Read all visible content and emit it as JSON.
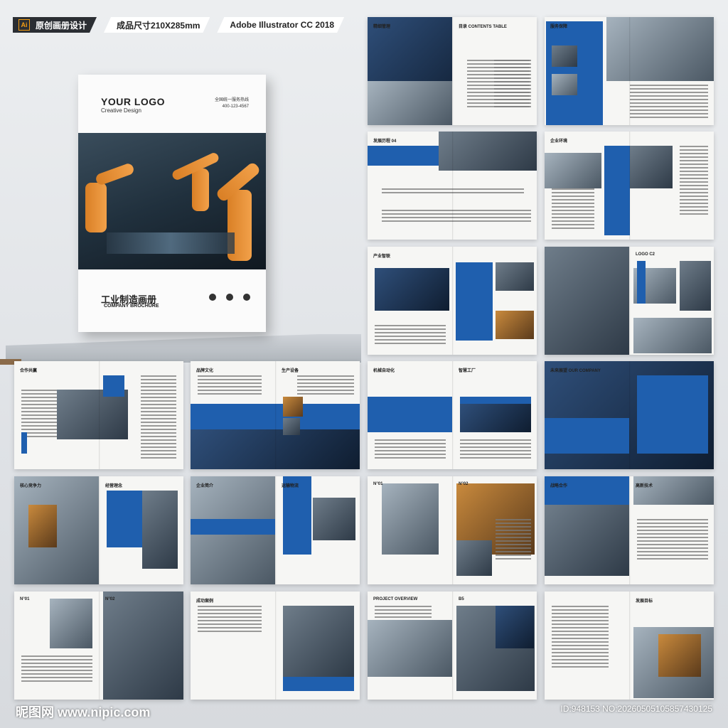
{
  "badges": {
    "software_icon": "Ai",
    "label": "原创画册设计",
    "size": "成品尺寸210X285mm",
    "software": "Adobe Illustrator CC 2018"
  },
  "cover": {
    "logo": "YOUR LOGO",
    "logo_sub": "Creative Design",
    "hotline_label": "全国统一服务热线",
    "hotline_number": "400-123-4567",
    "title": "工业制造画册",
    "title_en": "COMPANY BROCHURE"
  },
  "spreads": [
    {
      "left_title": "精细管理",
      "right_title": "目录 CONTENTS TABLE"
    },
    {
      "left_title": "服务保障",
      "right_title": ""
    },
    {
      "left_title": "发展历程 04",
      "right_title": ""
    },
    {
      "left_title": "企业环境",
      "right_title": ""
    },
    {
      "left_title": "产业智联",
      "right_title": ""
    },
    {
      "left_title": "",
      "right_title": "LOGO C2"
    },
    {
      "left_title": "合作共赢",
      "right_title": ""
    },
    {
      "left_title": "品牌文化",
      "right_title": "生产设备"
    },
    {
      "left_title": "机械自动化",
      "right_title": "智慧工厂"
    },
    {
      "left_title": "未来展望 OUR COMPANY",
      "right_title": ""
    },
    {
      "left_title": "核心竞争力",
      "right_title": "经营理念"
    },
    {
      "left_title": "企业简介",
      "right_title": "运输物流"
    },
    {
      "left_title": "N°01",
      "right_title": "N°02"
    },
    {
      "left_title": "战略合作",
      "right_title": "高新技术"
    },
    {
      "left_title": "N°01",
      "right_title": "N°02"
    },
    {
      "left_title": "成功案例",
      "right_title": ""
    },
    {
      "left_title": "PROJECT OVERVIEW",
      "right_title": "B5"
    },
    {
      "left_title": "",
      "right_title": "发展目标"
    }
  ],
  "footer": {
    "site": "昵图网 www.nipic.com",
    "id": "ID:948153 NO:20260505105857430125"
  }
}
